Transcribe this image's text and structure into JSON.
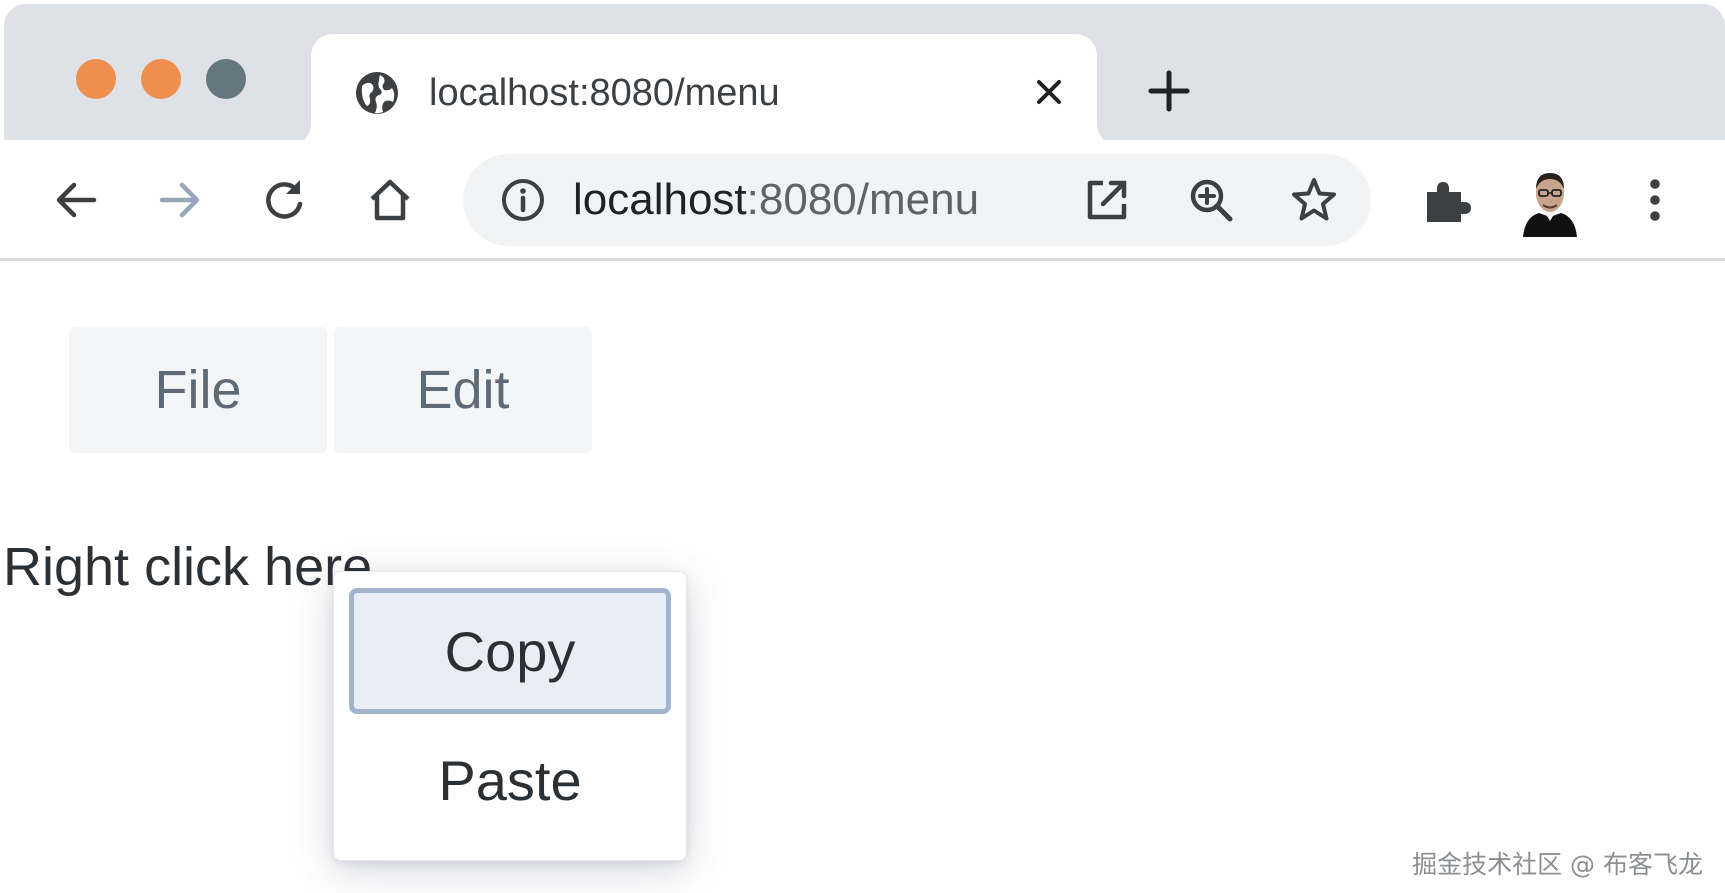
{
  "browser": {
    "tab": {
      "title": "localhost:8080/menu"
    },
    "address_bar": {
      "host": "localhost",
      "rest": ":8080/menu"
    },
    "toolbar_icons": [
      "back-arrow-icon",
      "forward-arrow-icon",
      "reload-icon",
      "home-icon",
      "site-info-icon",
      "open-in-new-icon",
      "zoom-icon",
      "bookmark-star-icon",
      "extensions-puzzle-icon",
      "profile-avatar",
      "more-menu-icon"
    ],
    "traffic_lights": {
      "close": "#ee8f4f",
      "minimize": "#ee8f4f",
      "maximize": "#65767d"
    }
  },
  "page": {
    "menubar": {
      "items": [
        {
          "label": "File"
        },
        {
          "label": "Edit"
        }
      ]
    },
    "right_click_text": "Right click here",
    "context_menu": {
      "items": [
        {
          "label": "Copy",
          "state": "hovered"
        },
        {
          "label": "Paste",
          "state": "normal"
        }
      ]
    }
  },
  "watermark": "掘金技术社区 @ 布客飞龙",
  "colors": {
    "menu_active_bg": "#e8edf6",
    "menu_active_border": "#a3b4cd",
    "menubar_bg": "#f4f5f6"
  }
}
